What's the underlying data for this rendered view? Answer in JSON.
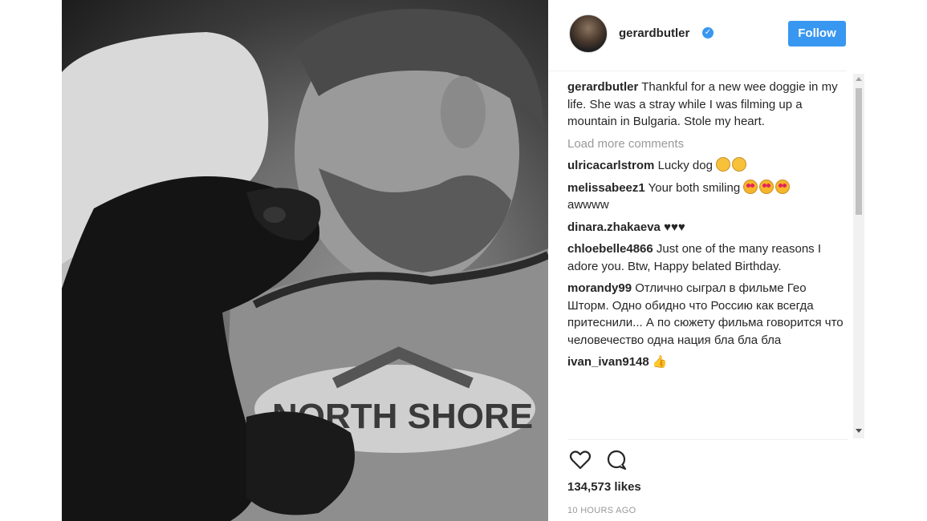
{
  "post": {
    "author": "gerardbutler",
    "follow_label": "Follow",
    "verified_glyph": "✓",
    "caption": "Thankful for a new wee doggie in my life. She was a stray while I was filming up a mountain in Bulgaria. Stole my heart.",
    "load_more": "Load more comments",
    "likes": "134,573 likes",
    "time": "10 HOURS AGO"
  },
  "photo": {
    "shirt_text": "NORTH SHORE"
  },
  "comments": [
    {
      "user": "ulricacarlstrom",
      "text": "Lucky dog",
      "emoji": [
        "wink",
        "persevere"
      ]
    },
    {
      "user": "melissabeez1",
      "text": "Your both smiling",
      "emoji": [
        "heart-eyes",
        "heart-eyes",
        "heart-eyes"
      ],
      "after": "awwww"
    },
    {
      "user": "dinara.zhakaeva",
      "text": "♥♥♥"
    },
    {
      "user": "chloebelle4866",
      "text": "Just one of the many reasons I adore you. Btw, Happy belated Birthday."
    },
    {
      "user": "morandy99",
      "text": "Отлично сыграл в фильме Гео Шторм. Одно обидно что Россию как всегда притеснили... А по сюжету фильма говорится что человечество одна нация бла бла бла"
    },
    {
      "user": "ivan_ivan9148",
      "text": "👍"
    }
  ],
  "icons": {
    "like": "heart-icon",
    "comment": "comment-icon",
    "verified": "verified-badge-icon"
  },
  "colors": {
    "accent": "#3897f0",
    "muted": "#999999",
    "text": "#262626"
  }
}
